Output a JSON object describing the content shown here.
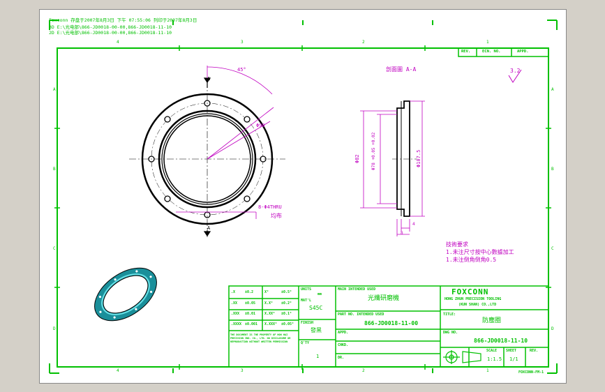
{
  "header": {
    "line1": "Foxconn  存盘于2007年8月3日 下午 07:55:06  列印于2007年8月3日",
    "line2": "3D   E:\\光电部\\866-JD0018-00-00,866-JD0018-11-10",
    "line3": "2D   E:\\光电部\\866-JD0018-00-00,866-JD0018-11-10"
  },
  "revision_table": {
    "rev": "REV.",
    "ecn": "ECN. NO.",
    "appd": "APPD."
  },
  "surface_finish": "3.2",
  "section_title": "剖面圖 A-A",
  "section_label": "A",
  "front_view": {
    "angle": "45°",
    "dim_hole_circle": "Φ99",
    "hole_callout": "8-Φ4THRU",
    "hole_note": "均布"
  },
  "section_view": {
    "dim_d82": "Φ82",
    "dim_d78": "Φ78 +0.05 +0.02",
    "dim_d107": "Φ107.5",
    "dim_4": "4",
    "dim_8": "8"
  },
  "tech_req": {
    "title": "技術要求",
    "line1": "1.未注尺寸按中心數據加工",
    "line2": "1.未注倒角倒角0.5"
  },
  "zones": {
    "cols": [
      "4",
      "3",
      "2",
      "1"
    ],
    "rows": [
      "A",
      "B",
      "C",
      "D"
    ]
  },
  "title_block": {
    "tol_rows": [
      [
        ".X",
        "±0.2",
        "X°",
        "±0.5°"
      ],
      [
        ".XX",
        "±0.05",
        "X.X°",
        "±0.2°"
      ],
      [
        ".XXX",
        "±0.01",
        "X.XX°",
        "±0.1°"
      ],
      [
        ".XXXX",
        "±0.001",
        "X.XXX°",
        "±0.05°"
      ]
    ],
    "units_label": "UNITS",
    "units_value": "mm",
    "matl_label": "MAT'L",
    "matl_value": "S45C",
    "finish_label": "FINISH",
    "finish_value": "發黑",
    "qty_label": "Q'TY",
    "qty_value": "1",
    "main_assy_label": "MAIN INTENDED USED",
    "main_assy_value": "光纖研磨機",
    "part_no_label": "PART NO. INTENDED USED",
    "part_no_value": "866-JD0018-11-00",
    "appd_label": "APPD.",
    "chkd_label": "CHKD.",
    "dr_label": "DR.",
    "company_logo": "FOXCONN",
    "company_line1": "HONG ZHUN PRECISION TOOLING",
    "company_line2": "(KUN SHAN) CO.,LTD",
    "title_label": "TITLE:",
    "title_value": "防塵圈",
    "dwg_label": "DWG NO.",
    "dwg_value": "866-JD0018-11-10",
    "scale_label": "SCALE",
    "scale_value": "1:1.5",
    "sheet_label": "SHEET",
    "sheet_value": "1/1",
    "rev_label": "REV.",
    "fine_print": "THE DOCUMENT IS THE PROPERTY OF HON HAI PRECISION IND. CO., LTD. NO DISCLOSURE OR REPRODUCTION WITHOUT WRITTEN PERMISSION",
    "form_no": "FOXCONN-FM-1"
  }
}
